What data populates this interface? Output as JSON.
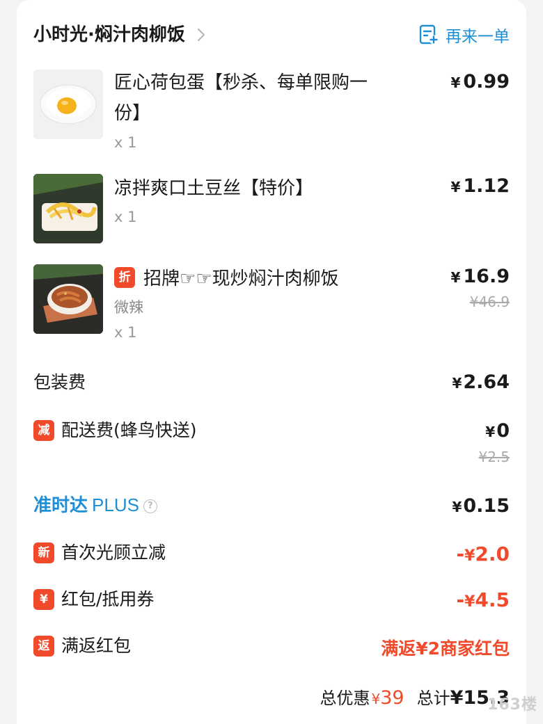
{
  "shop": {
    "name": "小时光·焖汁肉柳饭",
    "reorder_label": "再来一单"
  },
  "items": [
    {
      "name_line1": "匠心荷包蛋【秒杀、每单限购一",
      "name_line2": "份】",
      "qty": "x 1",
      "price_symbol": "¥",
      "price": "0.99"
    },
    {
      "name_line1": "凉拌爽口土豆丝【特价】",
      "qty": "x 1",
      "price_symbol": "¥",
      "price": "1.12"
    },
    {
      "tag": "折",
      "name_line1": "招牌☞☞现炒焖汁肉柳饭",
      "spec": "微辣",
      "qty": "x 1",
      "price_symbol": "¥",
      "price": "16.9",
      "original_price": "¥46.9"
    }
  ],
  "fees": {
    "packaging": {
      "label": "包装费",
      "symbol": "¥",
      "value": "2.64"
    },
    "delivery": {
      "tag": "减",
      "label": "配送费(蜂鸟快送)",
      "symbol": "¥",
      "value": "0",
      "original": "¥2.5"
    },
    "ontime": {
      "label": "准时达",
      "suffix": "PLUS",
      "help": "?",
      "symbol": "¥",
      "value": "0.15"
    },
    "first_visit": {
      "tag": "新",
      "label": "首次光顾立减",
      "sign": "-",
      "symbol": "¥",
      "value": "2.0"
    },
    "coupon": {
      "tag": "¥",
      "label": "红包/抵用券",
      "sign": "-",
      "symbol": "¥",
      "value": "4.5"
    },
    "rebate": {
      "tag": "返",
      "label": "满返红包",
      "value": "满返¥2商家红包"
    }
  },
  "summary": {
    "discount_label": "总优惠",
    "discount_symbol": "¥",
    "discount_value": "39",
    "total_label": "总计",
    "total_symbol": "¥",
    "total_value": "15.3"
  },
  "watermark": "163楼",
  "colors": {
    "accent_blue": "#1e8fd6",
    "discount_red": "#f04a2a"
  }
}
